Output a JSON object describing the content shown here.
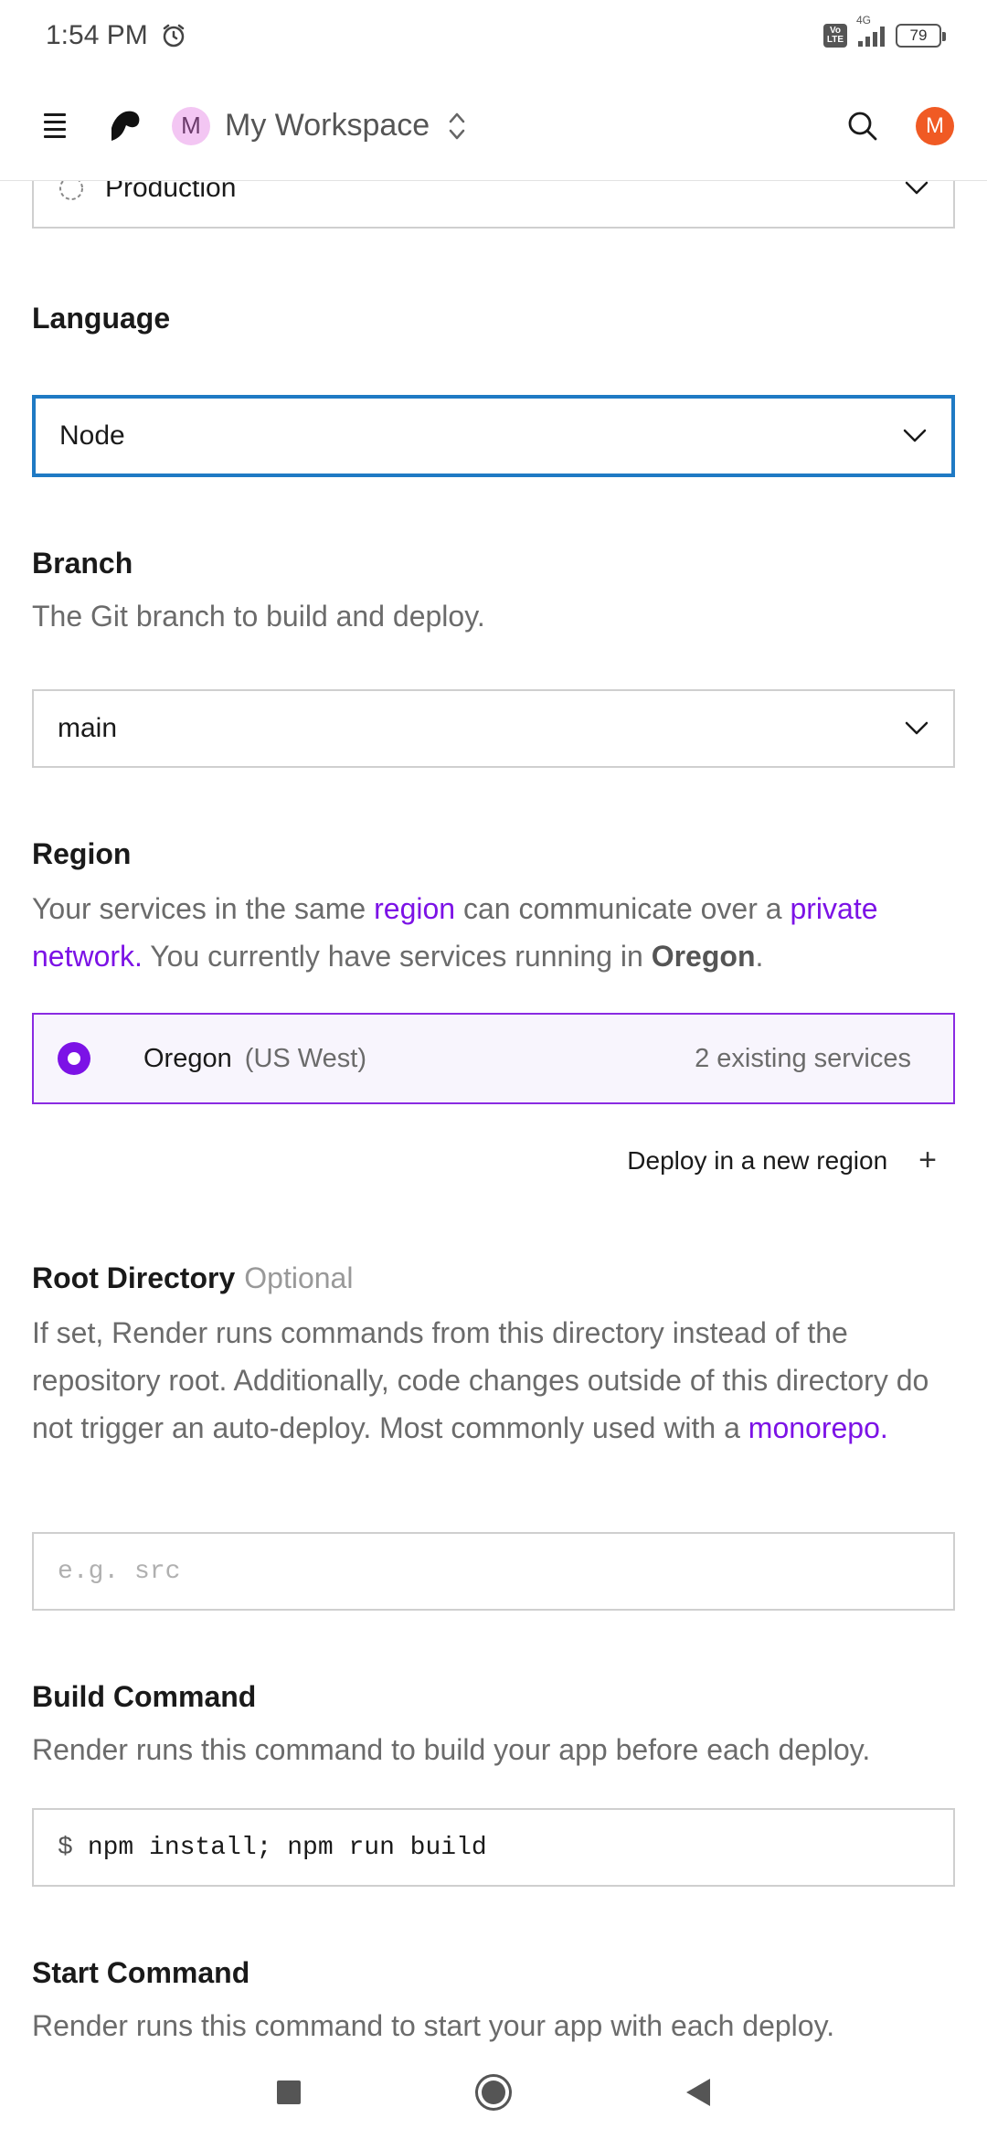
{
  "status_bar": {
    "time": "1:54 PM",
    "network": "4G",
    "volte": "Vo LTE",
    "battery": "79"
  },
  "header": {
    "workspace_initial": "M",
    "workspace_name": "My Workspace",
    "user_initial": "M"
  },
  "environment": {
    "value": "Production"
  },
  "language": {
    "heading": "Language",
    "value": "Node"
  },
  "branch": {
    "heading": "Branch",
    "description": "The Git branch to build and deploy.",
    "value": "main"
  },
  "region": {
    "heading": "Region",
    "desc_part1": "Your services in the same ",
    "desc_link1": "region",
    "desc_part2": " can communicate over a ",
    "desc_link2": "private network.",
    "desc_part3": " You currently have services running in ",
    "desc_bold": "Oregon",
    "desc_part4": ".",
    "option_name": "Oregon",
    "option_sub": "(US West)",
    "option_count": "2 existing services",
    "deploy_new": "Deploy in a new region"
  },
  "root_directory": {
    "heading": "Root Directory",
    "optional": "Optional",
    "description": "If set, Render runs commands from this directory instead of the repository root. Additionally, code changes outside of this directory do not trigger an auto-deploy. Most commonly used with a ",
    "desc_link": "monorepo.",
    "placeholder": "e.g. src"
  },
  "build_command": {
    "heading": "Build Command",
    "description": "Render runs this command to build your app before each deploy.",
    "prompt": "$",
    "value": "npm install; npm run build"
  },
  "start_command": {
    "heading": "Start Command",
    "description": "Render runs this command to start your app with each deploy."
  },
  "colors": {
    "accent": "#7c12e6",
    "focus_border": "#1f7ac4",
    "user_avatar": "#f05a24",
    "workspace_avatar": "#f3c6f3"
  }
}
